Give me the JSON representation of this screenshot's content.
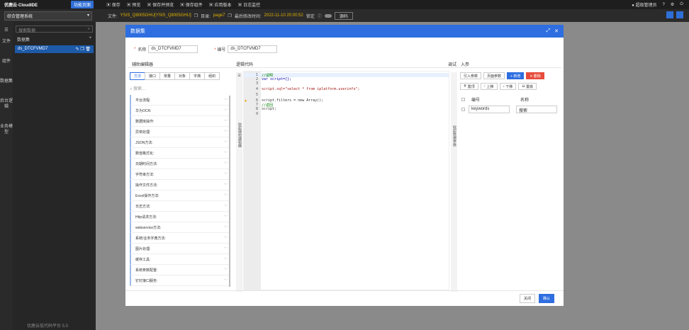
{
  "topbar": {
    "logo": "优鹿云·CloudIDE",
    "feature_btn": "功能页面",
    "menu": [
      "保存",
      "预览",
      "保存并预览",
      "保存组件",
      "应用版本",
      "日志监控"
    ],
    "user": "超级管理员",
    "icons": [
      "help-icon",
      "settings-icon",
      "logout-icon"
    ]
  },
  "subbar": {
    "system": "综合管理系统",
    "file_label": "文件:",
    "file_value": "YSIS_Q8005GHU[YSIS_Q8005GHU]",
    "dir_label": "目录:",
    "dir_value": "page7",
    "modified_label": "最后修改时间:",
    "modified_value": "2022-11-10 20:00:52",
    "lock_label": "锁定",
    "source_btn": "源码"
  },
  "rail": [
    "文件",
    "组件",
    "数据集",
    "后台逻辑",
    "业务模型"
  ],
  "panel": {
    "search_placeholder": "搜索数据",
    "section": "数据集",
    "item": "ds_DTCFVMD7",
    "footer": "优鹿云低代码平台 5.0"
  },
  "modal": {
    "title": "数据集",
    "name_label": "名称",
    "name_value": "ds_DTCFVMD7",
    "code_label": "编号",
    "code_value": "ds_DTCFVMD7",
    "helper_title": "辅助编辑器",
    "logic_title": "逻辑代码",
    "debug_title": "调试",
    "params_title": "入参",
    "tabs": [
      "方法",
      "接口",
      "常量",
      "对象",
      "字典",
      "组织"
    ],
    "helper_search": "搜索...",
    "tree": [
      "平台流程:",
      "华为OCR:",
      "数据库操作:",
      "异常处理:",
      "JSON方法:",
      "数值格式化:",
      "日期时间方法:",
      "字符串方法:",
      "操作文件方法:",
      "Excel操作方法:",
      "日志方法:",
      "Http请求方法:",
      "webservice方法:",
      "系统/业务字典方法:",
      "图片处理:",
      "缓存工具:",
      "系统参数配置:",
      "钉钉接口服务:"
    ],
    "collapse_helper": "收起辅助编辑器",
    "collapse_params": "收起数据参数",
    "code_lines": [
      {
        "n": "1",
        "t": "//说明"
      },
      {
        "n": "2",
        "t": "var script={};"
      },
      {
        "n": "3",
        "t": ""
      },
      {
        "n": "4",
        "t": "script.sql=\"select * from iplatform.userinfo\";"
      },
      {
        "n": "5",
        "t": ""
      },
      {
        "n": "6",
        "t": "script.filters = new Array();"
      },
      {
        "n": "7",
        "t": "//返回"
      },
      {
        "n": "8",
        "t": "script;"
      },
      {
        "n": "9",
        "t": ""
      }
    ],
    "param_btns_row1": [
      "引入参数",
      "页面参数",
      "+ 新增",
      "✕ 删除"
    ],
    "param_btns_row2": [
      "置顶",
      "上移",
      "下移",
      "置底"
    ],
    "param_cols": [
      "编号",
      "名称"
    ],
    "param_row": {
      "code": "keywords",
      "name": "搜索"
    },
    "close_btn": "关闭",
    "ok_btn": "确认"
  }
}
